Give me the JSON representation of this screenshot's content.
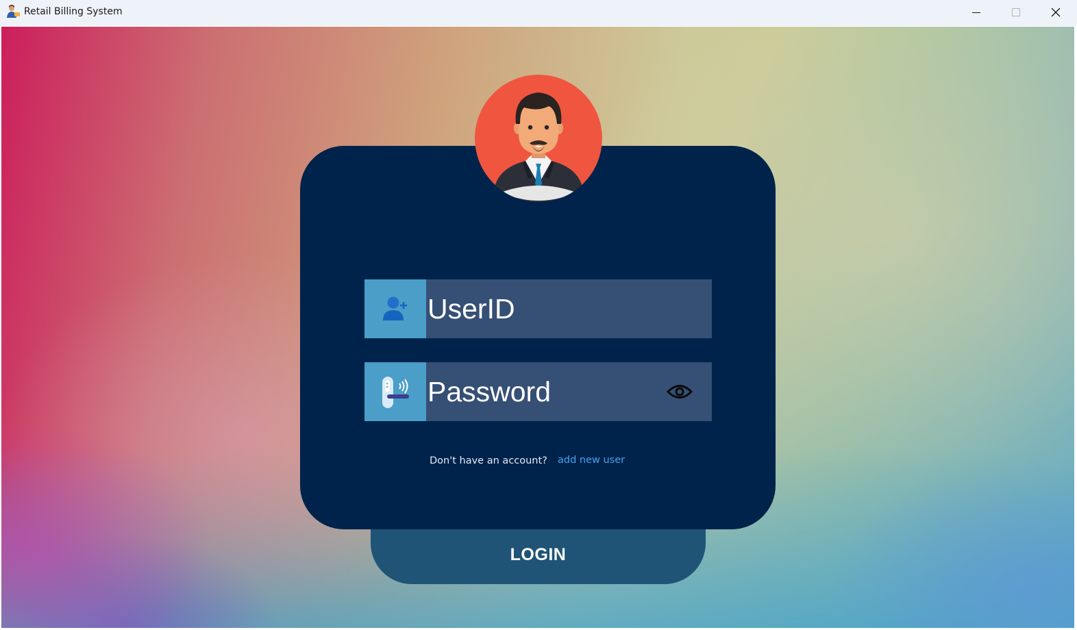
{
  "window": {
    "title": "Retail Billing System",
    "controls": [
      "minimize",
      "maximize",
      "close"
    ]
  },
  "login": {
    "avatar_icon": "businessman-avatar-icon",
    "userid": {
      "placeholder": "UserID",
      "value": "",
      "icon": "add-user-icon"
    },
    "password": {
      "placeholder": "Password",
      "value": "",
      "icon": "door-lock-icon",
      "toggle_icon": "eye-icon"
    },
    "signup_prompt": "Don't have an account?",
    "signup_link": "add new user",
    "login_button": "LOGIN"
  },
  "colors": {
    "card": "#00234b",
    "field_bg": "#364f75",
    "field_icon_bg": "#4a9ec7",
    "login_button": "#1f5476",
    "link": "#4aa3f0",
    "avatar_bg": "#f05540"
  }
}
